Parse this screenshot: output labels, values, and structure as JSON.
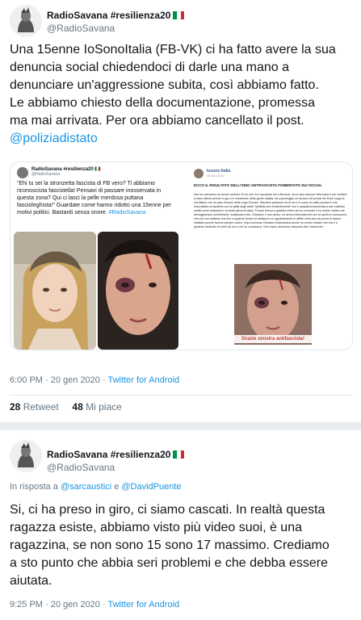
{
  "tweet1": {
    "display_name": "RadioSavana #resilienza20",
    "handle": "@RadioSavana",
    "text_lines": [
      "Una 15enne IoSonoItalia (FB-VK) ci ha fatto avere la sua",
      "denuncia social chiedendoci di darle una mano a",
      "denunciare un'aggressione subita, così abbiamo fatto.",
      "Le abbiamo chiesto della documentazione, promessa",
      "ma mai arrivata. Per ora abbiamo cancellato il post."
    ],
    "mention": "@poliziadistato",
    "quoted": {
      "display_name": "RadioSavana #resilienza20 🇮🇹",
      "handle": "@RadioSavana",
      "text": "\"Ehi tu sei la stronzetta fascista di FB vero? Ti abbiamo riconosciuta fascistella! Pensavi di passare inosservata in questa zona? Qui ci lasci la pelle merdosa puttana fascioleghista!\" Guardate come hanno ridotto una 15enne per motivi politici. Bastardi senza onore.",
      "hashtag": "#RadioSavana"
    },
    "fb_post": {
      "name": "Iosono Italia",
      "date": "40 dic 19:40",
      "title": "ECCO IL RISULTATO DELL'ODIO ANTIFASCISTA FOMENTATO SUI SOCIAL",
      "body": "Non so nemmeno se dovrei scrivere di ciò che mi è accaduto ieri a Brescia, ma lo farò solo per informarvi e per invitarvi a stare attenti perché in giro c'è veramente della gente malata. Ieri pomeriggio mi trovavo nei pressi del Esse lungo di via Milano con un paio di amici della Lega Giovani. Stavamo parlando tra di noi e io come al solito portavo il mio braccialetto ornamento con la spilla degli arditi. Spilletta che evidentemente non è passata inosservata a due individui vestiti come straccioni e la testa piena di rasta. Si sono messi a qualche metro da noi a fumare e ho subito notato che armeggiavano coi telefonini, scattavano foto. Giovanni, il mio amico, mi aveva informata che uno di quelli lo conosceva, che era uno sfattone che fino a qualche tempo fa abitava in un appartamento in affitto nella sua via prima di essere sfrattato perché faceva sempre casini. Il tipo secondo Giovanni frequentava anche un centro sociale che era lì a qualche centinaio di metri da noi e che lui conosceva. Non erano nemmeno trascorsi dieci minuti che",
      "caption": "Grazie sinistra antifascista!"
    },
    "time": "6:00 PM · 20 gen 2020",
    "source": "Twitter for Android",
    "retweets_count": "28",
    "retweets_label": "Retweet",
    "likes_count": "48",
    "likes_label": "Mi piace"
  },
  "tweet2": {
    "display_name": "RadioSavana #resilienza20",
    "handle": "@RadioSavana",
    "reply_prefix": "In risposta a",
    "reply_user1": "@sarcaustici",
    "reply_conj": "e",
    "reply_user2": "@DavidPuente",
    "text_lines": [
      "Si, ci ha preso in giro, ci siamo cascati. In realtà questa",
      "ragazza esiste, abbiamo visto più video suoi, è una",
      "ragazzina, se non sono 15 sono 17 massimo. Crediamo",
      "a sto punto che abbia seri problemi e che debba essere",
      "aiutata."
    ],
    "time": "9:25 PM · 20 gen 2020",
    "source": "Twitter for Android"
  },
  "colors": {
    "link": "#1b95e0",
    "muted": "#657786",
    "text": "#14171a",
    "separator": "#e6ecf0"
  }
}
